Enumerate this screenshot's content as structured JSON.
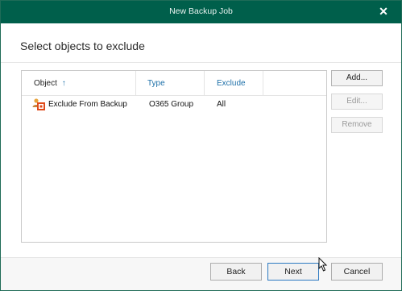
{
  "window": {
    "title": "New Backup Job",
    "close_glyph": "✕"
  },
  "page": {
    "heading": "Select objects to exclude"
  },
  "table": {
    "columns": [
      {
        "label": "Object",
        "sort_indicator": "↑"
      },
      {
        "label": "Type"
      },
      {
        "label": "Exclude"
      }
    ],
    "rows": [
      {
        "icon": "office365-group-icon",
        "object": "Exclude From Backup",
        "type": "O365 Group",
        "exclude": "All"
      }
    ]
  },
  "side_buttons": {
    "add": "Add...",
    "edit": "Edit...",
    "remove": "Remove"
  },
  "footer_buttons": {
    "back": "Back",
    "next": "Next",
    "cancel": "Cancel"
  },
  "colors": {
    "titlebar": "#005f4b",
    "header_link": "#1c6fa8",
    "primary_border": "#2d7ac2"
  }
}
